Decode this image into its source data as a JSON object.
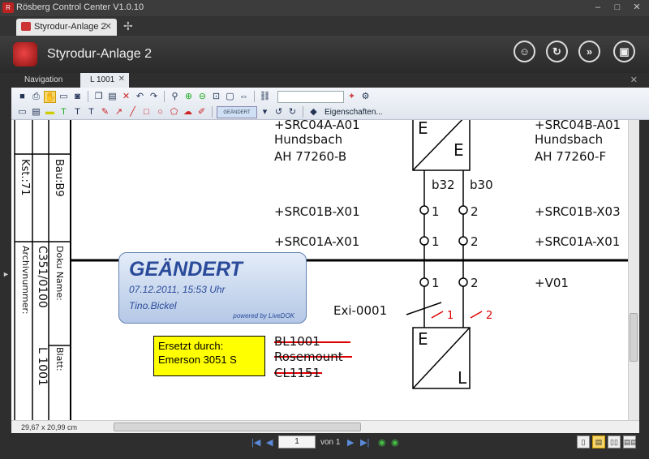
{
  "window": {
    "title": "Rösberg Control Center V1.0.10"
  },
  "tabs": [
    {
      "label": "Styrodur-Anlage 2"
    }
  ],
  "header": {
    "title": "Styrodur-Anlage 2",
    "buttons": [
      "user-icon",
      "refresh-icon",
      "forward-icon",
      "image-icon"
    ]
  },
  "panel_tabs": {
    "navigation": "Navigation",
    "document": "L 1001"
  },
  "toolbar": {
    "stamp_picker": "GEÄNDERT",
    "properties": "Eigenschaften..."
  },
  "drawing": {
    "title_block": {
      "kst": "Kst.:71",
      "bau": "Bau:B9",
      "archiv_label": "Archivnummer:",
      "doku_label": "Doku Name:",
      "doku_value": "C351/0100",
      "blatt_label": "Blatt:",
      "blatt_value": "L 1001"
    },
    "left_col": [
      "+SRC04A-A01",
      "Hundsbach",
      "AH 77260-B",
      "+SRC01B-X01",
      "+SRC01A-X01"
    ],
    "right_col": [
      "+SRC04B-A01",
      "Hundsbach",
      "AH 77260-F",
      "+SRC01B-X03",
      "+SRC01A-X01",
      "+V01"
    ],
    "terminals": {
      "b32": "b32",
      "b30": "b30",
      "n1": "1",
      "n2": "2"
    },
    "exi": "Exi-0001",
    "red_1": "1",
    "red_2": "2",
    "struck": [
      "BL1001",
      "Rosemount",
      "CL1151"
    ],
    "block_top": {
      "e": "E",
      "f": "E"
    },
    "block_bottom": {
      "e": "E",
      "l": "L"
    }
  },
  "stamp": {
    "title": "GEÄNDERT",
    "date": "07.12.2011, 15:53 Uhr",
    "user": "Tino.Bickel",
    "powered": "powered by LiveDOK"
  },
  "note": {
    "line1": "Ersetzt durch:",
    "line2": "Emerson 3051 S"
  },
  "status": {
    "size": "29,67 x 20,99 cm",
    "page": "1",
    "of": "von 1"
  },
  "colors": {
    "accent": "#2a4a9a",
    "note_bg": "#ffff00",
    "redline": "#d00000"
  }
}
